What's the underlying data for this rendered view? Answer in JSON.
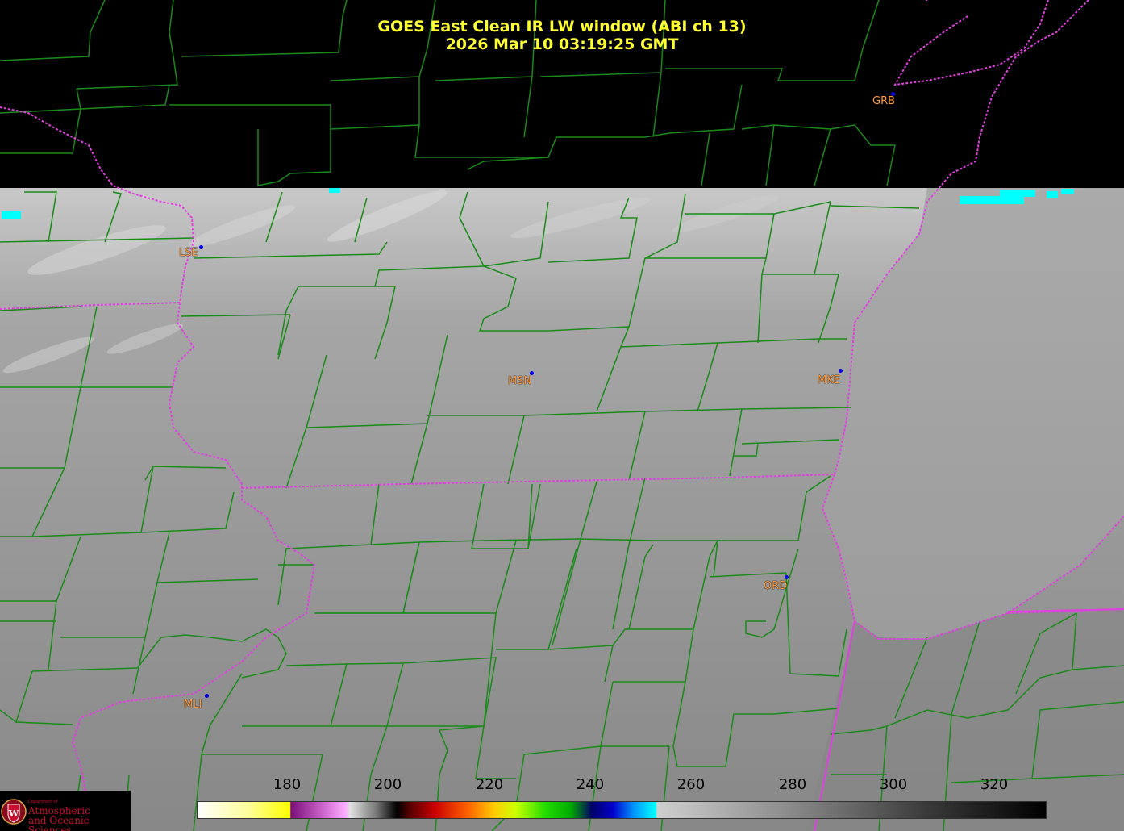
{
  "title": {
    "line1": "GOES East Clean IR LW window (ABI ch 13)",
    "line2": "2026 Mar 10  03:19:25 GMT"
  },
  "cities": [
    {
      "code": "GRB"
    },
    {
      "code": "LSE"
    },
    {
      "code": "MSN"
    },
    {
      "code": "MKE"
    },
    {
      "code": "ORD"
    },
    {
      "code": "MLI"
    }
  ],
  "colorbar": {
    "ticks": [
      "180",
      "200",
      "220",
      "240",
      "260",
      "280",
      "300",
      "320"
    ]
  },
  "logo": {
    "small": "Department of",
    "line1": "Atmospheric",
    "line2": "and Oceanic Sciences"
  },
  "colors": {
    "county_lines": "#1a8a1a",
    "state_lines": "#e040e0",
    "title_text": "#ffff33",
    "city_label": "#ff9a3c",
    "city_dot": "#0000ee"
  }
}
